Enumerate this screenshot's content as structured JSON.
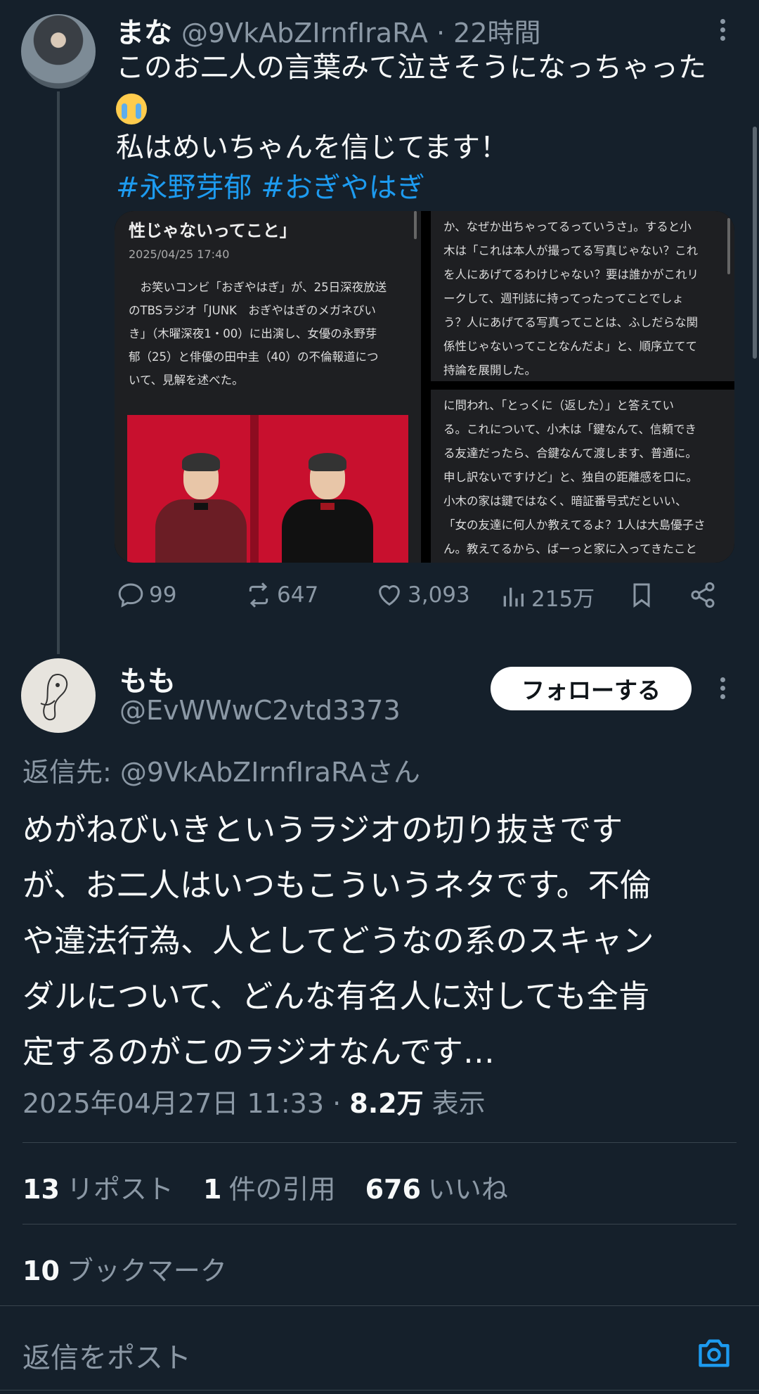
{
  "parent": {
    "name": "まな",
    "handle_time": "@9VkAbZIrnfIraRA · 22時間",
    "text_lines": [
      "このお二人の言葉みて泣きそうになっちゃった",
      "私はめいちゃんを信じてます！"
    ],
    "hashtags": [
      "#永野芽郁",
      "#おぎやはぎ"
    ],
    "article": {
      "headline": "性じゃないってこと」",
      "date": "2025/04/25 17:40",
      "body": [
        "　お笑いコンビ「おぎやはぎ」が、25日深夜放送",
        "のTBSラジオ「JUNK　おぎやはぎのメガネびい",
        "き」（木曜深夜1・00）に出演し、女優の永野芽",
        "郁（25）と俳優の田中圭（40）の不倫報道につ",
        "いて、見解を述べた。"
      ],
      "right_top": [
        "か、なぜか出ちゃってるっていうさ」。すると小",
        "木は「これは本人が撮ってる写真じゃない？これ",
        "を人にあげてるわけじゃない？要は誰かがこれリ",
        "ークして、週刊誌に持ってったってことでしょ",
        "う？人にあげてる写真ってことは、ふしだらな関",
        "係性じゃないってことなんだよ」と、順序立てて",
        "持論を展開した。"
      ],
      "right_bottom": [
        "に問われ、「とっくに（返した）」と答えてい",
        "る。これについて、小木は「鍵なんて、信頼でき",
        "る友達だったら、合鍵なんて渡します、普通に。",
        "申し訳ないですけど」と、独自の距離感を口に。",
        "小木の家は鍵ではなく、暗証番号式だといい、",
        "「女の友達に何人か教えてるよ？1人は大島優子さ",
        "ん。教えてるから、ばーっと家に入ってきたこと"
      ]
    },
    "actions": {
      "replies": "99",
      "reposts": "647",
      "likes": "3,093",
      "views": "215万"
    }
  },
  "reply": {
    "name": "もも",
    "handle": "@EvWWwC2vtd3373",
    "follow_label": "フォローする",
    "reply_to": "返信先: ",
    "reply_to_handle": "@9VkAbZIrnfIraRA",
    "reply_to_suffix": "さん",
    "body_lines": [
      "めがねびいきというラジオの切り抜きです",
      "が、お二人はいつもこういうネタです。不倫",
      "や違法行為、人としてどうなの系のスキャン",
      "ダルについて、どんな有名人に対しても全肯",
      "定するのがこのラジオなんです…"
    ],
    "timestamp": "2025年04月27日 11:33 · ",
    "views_count": "8.2万",
    "views_label": " 表示",
    "stats": {
      "reposts_count": "13",
      "reposts_label": "リポスト",
      "quotes_count": "1",
      "quotes_label": "件の引用",
      "likes_count": "676",
      "likes_label": "いいね",
      "bookmarks_count": "10",
      "bookmarks_label": "ブックマーク"
    }
  },
  "composer": {
    "placeholder": "返信をポスト"
  },
  "colors": {
    "background": "#15202b",
    "accent": "#1d9bf0",
    "muted": "#8b98a5"
  }
}
